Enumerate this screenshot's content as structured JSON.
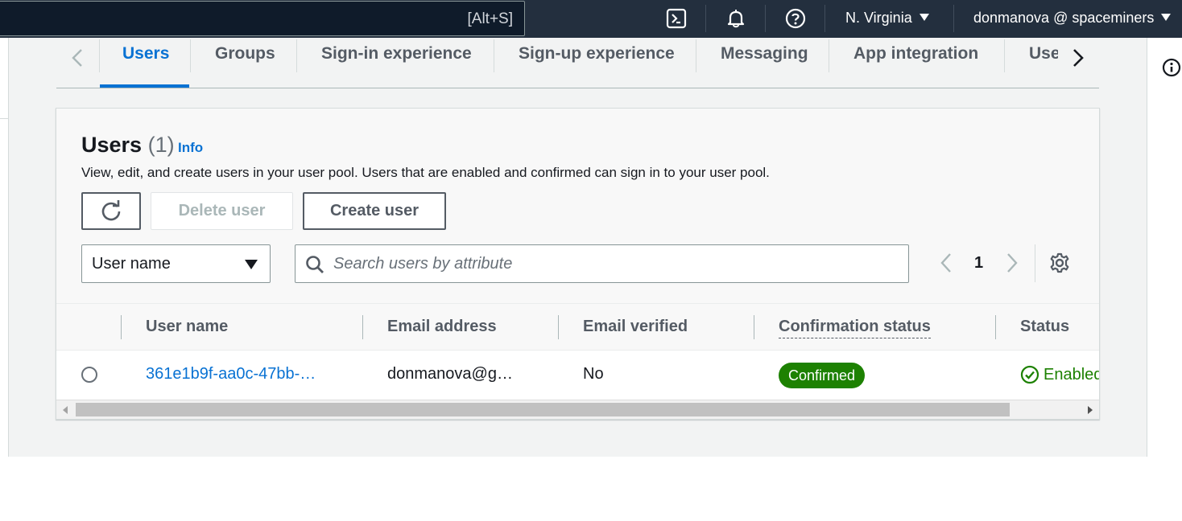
{
  "topbar": {
    "search_shortcut": "[Alt+S]",
    "region": "N. Virginia",
    "account": "donmanova @ spaceminers",
    "icons": [
      "cloudshell-icon",
      "bell-icon",
      "help-icon"
    ]
  },
  "tabs": [
    {
      "label": "Users",
      "active": true
    },
    {
      "label": "Groups",
      "active": false
    },
    {
      "label": "Sign-in experience",
      "active": false
    },
    {
      "label": "Sign-up experience",
      "active": false
    },
    {
      "label": "Messaging",
      "active": false
    },
    {
      "label": "App integration",
      "active": false
    },
    {
      "label": "Use",
      "active": false
    }
  ],
  "panel": {
    "title": "Users",
    "count": "(1)",
    "info": "Info",
    "description": "View, edit, and create users in your user pool. Users that are enabled and confirmed can sign in to your user pool.",
    "delete_label": "Delete user",
    "create_label": "Create user",
    "filter_select": "User name",
    "search_placeholder": "Search users by attribute",
    "page": "1"
  },
  "table": {
    "columns": [
      "User name",
      "Email address",
      "Email verified",
      "Confirmation status",
      "Status"
    ],
    "rows": [
      {
        "user_name": "361e1b9f-aa0c-47bb-…",
        "email": "donmanova@g…",
        "email_verified": "No",
        "confirmation_status": "Confirmed",
        "status": "Enabled"
      }
    ]
  },
  "colors": {
    "topbar": "#232f3e",
    "link": "#0972d3",
    "success": "#1d8102"
  }
}
